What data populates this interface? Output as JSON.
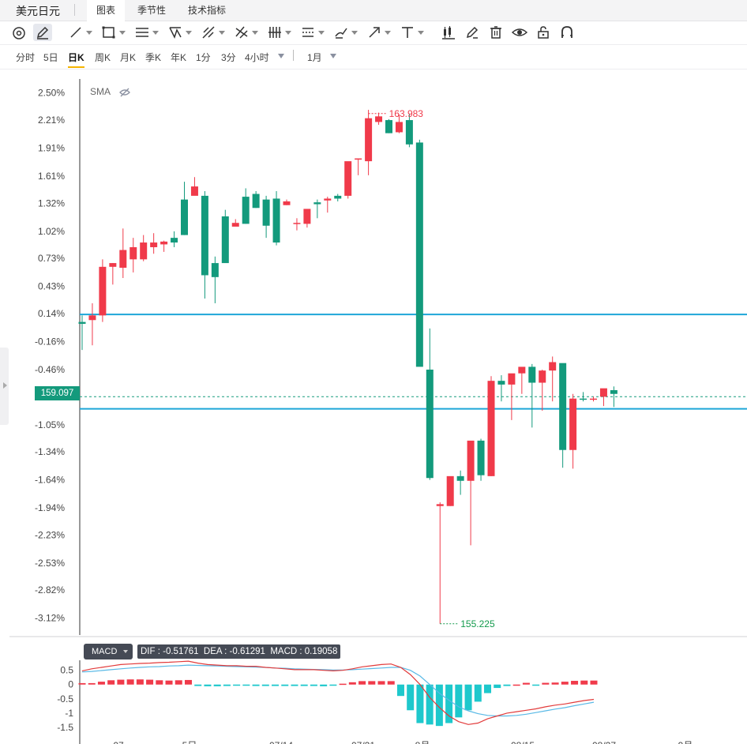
{
  "app": {
    "title": "美元日元"
  },
  "tabs": [
    {
      "label": "图表",
      "active": true
    },
    {
      "label": "季节性",
      "active": false
    },
    {
      "label": "技术指标",
      "active": false
    }
  ],
  "toolbar_icons": [
    "ring-icon",
    "pencil-icon",
    "line-icon",
    "rectangle-icon",
    "channel-icon",
    "pattern-icon",
    "fib-icon",
    "cross-lines-icon",
    "bars-icon",
    "measure-icon",
    "brush-icon",
    "arrow-icon",
    "text-icon",
    "candle-settings-icon",
    "edit-icon",
    "trash-icon",
    "eye-icon",
    "lock-icon",
    "magnet-icon"
  ],
  "periods": [
    {
      "label": "分时",
      "active": false
    },
    {
      "label": "5日",
      "active": false
    },
    {
      "label": "日K",
      "active": true
    },
    {
      "label": "周K",
      "active": false
    },
    {
      "label": "月K",
      "active": false
    },
    {
      "label": "季K",
      "active": false
    },
    {
      "label": "年K",
      "active": false
    },
    {
      "label": "1分",
      "active": false
    },
    {
      "label": "3分",
      "active": false
    },
    {
      "label": "4小时",
      "active": false
    }
  ],
  "range_label": "1月",
  "indicator_label": "SMA",
  "colors": {
    "up": "#f03a4a",
    "down": "#139a7c",
    "hline": "#1ea6d8",
    "dif": "#e23b3b",
    "dea": "#59b9e6",
    "macd_pos": "#f03a4a",
    "macd_neg": "#1ec8cc"
  },
  "chart_data": [
    {
      "type": "candlestick",
      "title": "",
      "y_unit": "% change",
      "ylim": [
        -3.3,
        2.65
      ],
      "y_ticks": [
        "2.50%",
        "2.21%",
        "1.91%",
        "1.61%",
        "1.32%",
        "1.02%",
        "0.73%",
        "0.43%",
        "0.14%",
        "-0.16%",
        "-0.46%",
        "-0.75%",
        "-1.05%",
        "-1.34%",
        "-1.64%",
        "-1.94%",
        "-2.23%",
        "-2.53%",
        "-2.82%",
        "-3.12%"
      ],
      "y_tick_values": [
        2.5,
        2.21,
        1.91,
        1.61,
        1.32,
        1.02,
        0.73,
        0.43,
        0.14,
        -0.16,
        -0.46,
        -0.75,
        -1.05,
        -1.34,
        -1.64,
        -1.94,
        -2.23,
        -2.53,
        -2.82,
        -3.12
      ],
      "current_price": "159.097",
      "current_value": -0.75,
      "max_label": "163.983",
      "min_label": "155.225",
      "max_value": 2.28,
      "min_value": -3.18,
      "horizontal_lines": [
        0.13,
        -0.88
      ],
      "candles": [
        [
          0.05,
          0.12,
          -0.25,
          0.03
        ],
        [
          0.07,
          0.25,
          -0.2,
          0.12
        ],
        [
          0.12,
          0.72,
          0.05,
          0.64
        ],
        [
          0.64,
          0.68,
          0.45,
          0.68
        ],
        [
          0.63,
          1.05,
          0.52,
          0.82
        ],
        [
          0.72,
          0.95,
          0.58,
          0.85
        ],
        [
          0.72,
          0.98,
          0.7,
          0.9
        ],
        [
          0.85,
          1.0,
          0.78,
          0.9
        ],
        [
          0.88,
          0.92,
          0.8,
          0.91
        ],
        [
          0.95,
          1.02,
          0.85,
          0.9
        ],
        [
          1.36,
          1.55,
          0.98,
          0.98
        ],
        [
          1.4,
          1.6,
          1.44,
          1.5
        ],
        [
          1.4,
          1.45,
          0.3,
          0.55
        ],
        [
          0.68,
          0.75,
          0.25,
          0.53
        ],
        [
          1.18,
          1.25,
          0.75,
          0.68
        ],
        [
          1.07,
          1.15,
          1.08,
          1.11
        ],
        [
          1.39,
          1.48,
          1.1,
          1.1
        ],
        [
          1.42,
          1.45,
          1.27,
          1.27
        ],
        [
          1.36,
          1.4,
          0.95,
          1.08
        ],
        [
          1.37,
          1.45,
          0.87,
          0.9
        ],
        [
          1.3,
          1.36,
          1.3,
          1.34
        ],
        [
          1.1,
          1.16,
          1.03,
          1.11
        ],
        [
          1.1,
          1.22,
          1.06,
          1.26
        ],
        [
          1.33,
          1.36,
          1.16,
          1.31
        ],
        [
          1.35,
          1.39,
          1.22,
          1.37
        ],
        [
          1.4,
          1.42,
          1.34,
          1.37
        ],
        [
          1.4,
          1.66,
          1.37,
          1.77
        ],
        [
          1.79,
          1.8,
          1.62,
          1.8
        ],
        [
          1.77,
          2.32,
          1.62,
          2.23
        ],
        [
          2.19,
          2.29,
          2.16,
          2.25
        ],
        [
          2.21,
          2.22,
          2.07,
          2.07
        ],
        [
          2.08,
          2.27,
          2.07,
          2.19
        ],
        [
          2.21,
          2.28,
          1.92,
          1.95
        ],
        [
          1.97,
          2.0,
          -0.14,
          -0.43
        ],
        [
          -0.46,
          -0.02,
          -1.64,
          -1.62
        ],
        [
          -1.92,
          -1.88,
          -3.18,
          -1.9
        ],
        [
          -1.92,
          -1.82,
          -1.92,
          -1.6
        ],
        [
          -1.6,
          -1.54,
          -1.8,
          -1.65
        ],
        [
          -1.65,
          -1.29,
          -2.34,
          -1.22
        ],
        [
          -1.22,
          -1.2,
          -1.65,
          -1.59
        ],
        [
          -1.6,
          -0.53,
          -1.6,
          -0.58
        ],
        [
          -0.58,
          -0.52,
          -0.8,
          -0.62
        ],
        [
          -0.62,
          -0.52,
          -1.0,
          -0.5
        ],
        [
          -0.5,
          -0.46,
          -0.72,
          -0.43
        ],
        [
          -0.43,
          -0.4,
          -1.08,
          -0.6
        ],
        [
          -0.6,
          -0.46,
          -0.9,
          -0.47
        ],
        [
          -0.47,
          -0.32,
          -0.8,
          -0.38
        ],
        [
          -0.39,
          -0.46,
          -1.51,
          -1.32
        ],
        [
          -1.32,
          -0.72,
          -1.52,
          -0.77
        ],
        [
          -0.77,
          -0.7,
          -0.8,
          -0.78
        ],
        [
          -0.78,
          -0.75,
          -0.8,
          -0.77
        ],
        [
          -0.75,
          -0.7,
          -0.85,
          -0.66
        ],
        [
          -0.68,
          -0.64,
          -0.86,
          -0.72
        ]
      ],
      "x_tick_labels": [
        "07",
        "5日",
        "07/14",
        "07/21",
        "8月",
        "08/15",
        "08/27",
        "9月"
      ]
    },
    {
      "type": "bar+line",
      "title": "MACD",
      "dif": "-0.51761",
      "dea": "-0.61291",
      "macd": "0.19058",
      "y_ticks": [
        "0.5",
        "0",
        "-0.5",
        "-1",
        "-1.5"
      ],
      "y_tick_values": [
        0.5,
        0,
        -0.5,
        -1,
        -1.5
      ],
      "ylim": [
        -1.75,
        0.85
      ],
      "histogram": [
        0.05,
        0.05,
        0.1,
        0.15,
        0.17,
        0.18,
        0.18,
        0.17,
        0.15,
        0.14,
        0.15,
        0.16,
        -0.05,
        -0.06,
        -0.06,
        -0.05,
        -0.04,
        -0.04,
        -0.05,
        -0.05,
        -0.05,
        -0.05,
        -0.05,
        -0.05,
        -0.05,
        -0.06,
        -0.03,
        0.03,
        0.08,
        0.12,
        0.12,
        0.12,
        0.12,
        -0.4,
        -0.9,
        -1.35,
        -1.4,
        -1.45,
        -1.35,
        -1.15,
        -0.9,
        -0.6,
        -0.3,
        -0.12,
        -0.05,
        0,
        0.06,
        -0.04,
        0.06,
        0.07,
        0.1,
        0.13,
        0.14,
        0.14
      ],
      "dif_line": [
        0.48,
        0.55,
        0.6,
        0.65,
        0.7,
        0.72,
        0.74,
        0.75,
        0.77,
        0.78,
        0.8,
        0.82,
        0.75,
        0.7,
        0.68,
        0.66,
        0.66,
        0.64,
        0.64,
        0.6,
        0.58,
        0.55,
        0.52,
        0.52,
        0.52,
        0.5,
        0.48,
        0.5,
        0.55,
        0.62,
        0.66,
        0.7,
        0.72,
        0.6,
        0.35,
        0.0,
        -0.45,
        -0.8,
        -1.1,
        -1.3,
        -1.4,
        -1.35,
        -1.2,
        -1.1,
        -1.0,
        -0.95,
        -0.9,
        -0.85,
        -0.78,
        -0.72,
        -0.68,
        -0.62,
        -0.56,
        -0.52
      ],
      "dea_line": [
        0.44,
        0.46,
        0.49,
        0.52,
        0.55,
        0.58,
        0.6,
        0.62,
        0.63,
        0.65,
        0.66,
        0.68,
        0.67,
        0.66,
        0.65,
        0.64,
        0.63,
        0.62,
        0.61,
        0.6,
        0.58,
        0.57,
        0.55,
        0.54,
        0.53,
        0.52,
        0.51,
        0.51,
        0.52,
        0.54,
        0.56,
        0.58,
        0.6,
        0.6,
        0.5,
        0.3,
        0.0,
        -0.3,
        -0.55,
        -0.78,
        -0.92,
        -1.02,
        -1.08,
        -1.1,
        -1.1,
        -1.08,
        -1.04,
        -0.98,
        -0.92,
        -0.86,
        -0.81,
        -0.74,
        -0.68,
        -0.62
      ]
    }
  ]
}
